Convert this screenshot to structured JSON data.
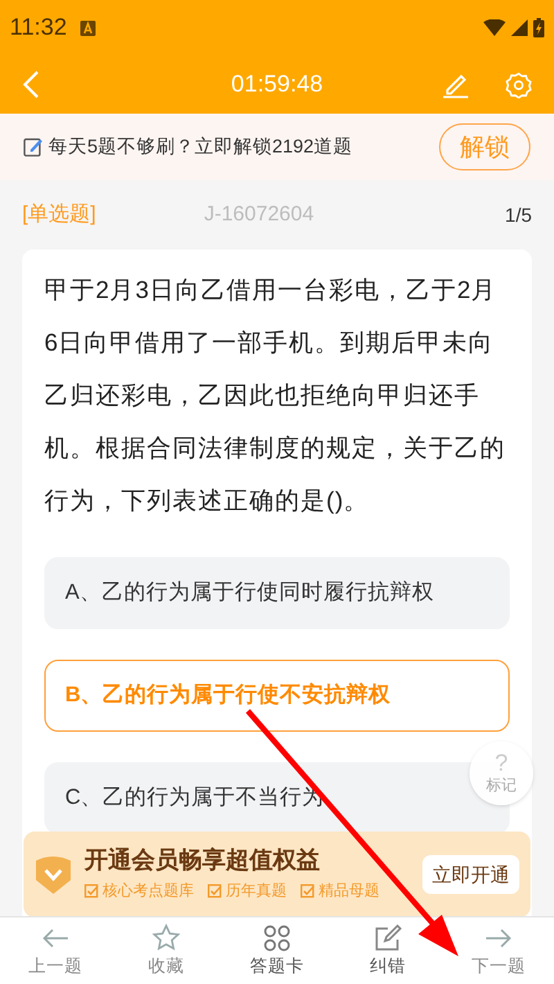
{
  "status_bar": {
    "time": "11:32"
  },
  "header": {
    "timer": "01:59:48"
  },
  "unlock_banner": {
    "text": "每天5题不够刷？立即解锁2192道题",
    "button": "解锁"
  },
  "question": {
    "type": "[单选题]",
    "code": "J-16072604",
    "progress": "1/5",
    "text": "甲于2月3日向乙借用一台彩电，乙于2月6日向甲借用了一部手机。到期后甲未向乙归还彩电，乙因此也拒绝向甲归还手机。根据合同法律制度的规定，关于乙的行为，下列表述正确的是()。"
  },
  "options": [
    {
      "text": "A、乙的行为属于行使同时履行抗辩权",
      "selected": false
    },
    {
      "text": "B、乙的行为属于行使不安抗辩权",
      "selected": true
    },
    {
      "text": "C、乙的行为属于不当行为",
      "selected": false
    }
  ],
  "mark_button": {
    "icon": "?",
    "label": "标记"
  },
  "vip_promo": {
    "title": "开通会员畅享超值权益",
    "features": [
      "核心考点题库",
      "历年真题",
      "精品母题"
    ],
    "button": "立即开通"
  },
  "bottom_nav": [
    {
      "label": "上一题",
      "kind": "prev"
    },
    {
      "label": "收藏",
      "kind": "star"
    },
    {
      "label": "答题卡",
      "kind": "grid"
    },
    {
      "label": "纠错",
      "kind": "edit"
    },
    {
      "label": "下一题",
      "kind": "next"
    }
  ]
}
